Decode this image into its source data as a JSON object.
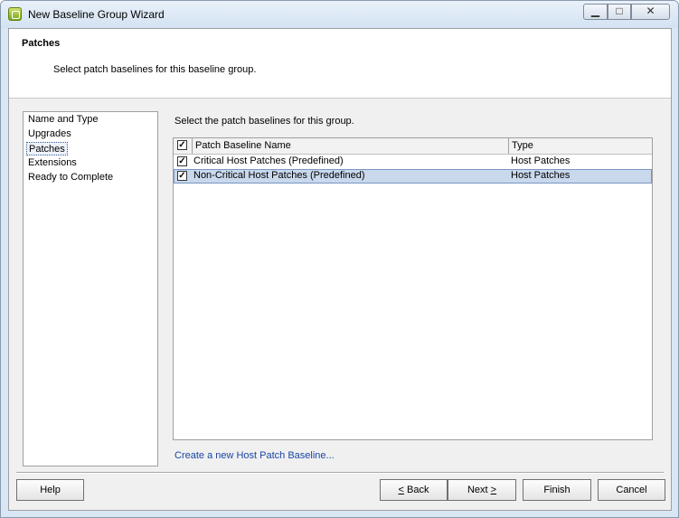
{
  "window": {
    "title": "New Baseline Group Wizard",
    "icon": "vsphere-update-manager-icon",
    "controls": {
      "minimize": "▁",
      "maximize": "□",
      "close": "✕"
    }
  },
  "header": {
    "title": "Patches",
    "subtitle": "Select patch baselines for this baseline group."
  },
  "steps": {
    "items": [
      {
        "label": "Name and Type"
      },
      {
        "label": "Upgrades"
      },
      {
        "label": "Patches"
      },
      {
        "label": "Extensions"
      },
      {
        "label": "Ready to Complete"
      }
    ],
    "selected_index": 2
  },
  "main": {
    "instruction": "Select the patch baselines for this group.",
    "grid": {
      "columns": [
        "Patch Baseline Name",
        "Type"
      ],
      "header_checked": true,
      "rows": [
        {
          "checked": true,
          "name": "Critical Host Patches (Predefined)",
          "type": "Host Patches",
          "selected": false
        },
        {
          "checked": true,
          "name": "Non-Critical Host Patches (Predefined)",
          "type": "Host Patches",
          "selected": true
        }
      ]
    },
    "create_link": "Create a new Host Patch Baseline..."
  },
  "footer": {
    "help": "Help",
    "back_prefix": "",
    "back_access": "<",
    "back_rest": " Back",
    "next_prefix": "Next ",
    "next_access": ">",
    "finish": "Finish",
    "cancel": "Cancel"
  },
  "colors": {
    "selection": "#c9d8ec",
    "link": "#1a46a4"
  }
}
